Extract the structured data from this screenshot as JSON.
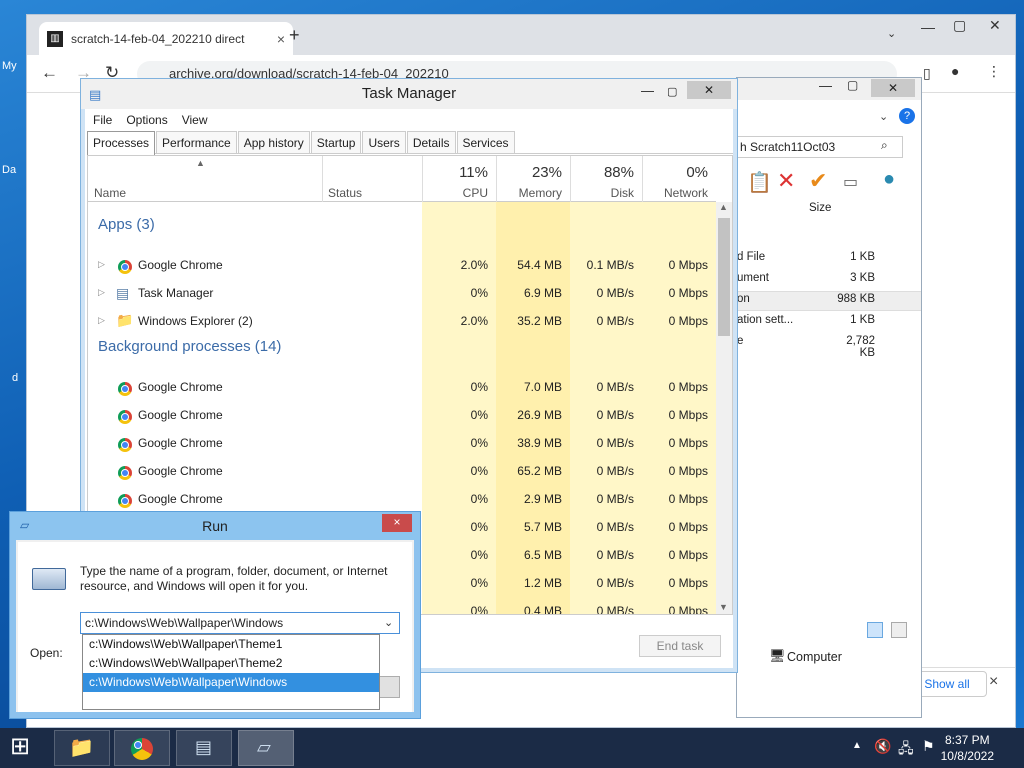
{
  "desktop": {
    "label_my": "My",
    "label_da": "Da",
    "label_d": "d"
  },
  "browser": {
    "tab_title": "scratch-14-feb-04_202210 direct",
    "tab_close": "×",
    "new_tab": "+",
    "url": "archive.org/download/scratch-14-feb-04_202210",
    "show_all": "Show all",
    "close_bar": "×"
  },
  "explorer": {
    "search_text": "h Scratch11Oct03",
    "size_header": "Size",
    "files": [
      {
        "name": "d File",
        "size": "1 KB"
      },
      {
        "name": "ument",
        "size": "3 KB"
      },
      {
        "name": "on",
        "size": "988 KB"
      },
      {
        "name": "ation sett...",
        "size": "1 KB"
      },
      {
        "name": "e",
        "size": "2,782 KB"
      }
    ],
    "status": "Computer"
  },
  "task_manager": {
    "title": "Task Manager",
    "menu": [
      "File",
      "Options",
      "View"
    ],
    "tabs": [
      "Processes",
      "Performance",
      "App history",
      "Startup",
      "Users",
      "Details",
      "Services"
    ],
    "columns": {
      "name": "Name",
      "status": "Status",
      "cpu": "CPU",
      "memory": "Memory",
      "disk": "Disk",
      "network": "Network"
    },
    "totals": {
      "cpu": "11%",
      "memory": "23%",
      "disk": "88%",
      "network": "0%"
    },
    "apps_group": "Apps (3)",
    "apps": [
      {
        "name": "Google Chrome",
        "cpu": "2.0%",
        "mem": "54.4 MB",
        "disk": "0.1 MB/s",
        "net": "0 Mbps"
      },
      {
        "name": "Task Manager",
        "cpu": "0%",
        "mem": "6.9 MB",
        "disk": "0 MB/s",
        "net": "0 Mbps"
      },
      {
        "name": "Windows Explorer (2)",
        "cpu": "2.0%",
        "mem": "35.2 MB",
        "disk": "0 MB/s",
        "net": "0 Mbps"
      }
    ],
    "bg_group": "Background processes (14)",
    "bg": [
      {
        "name": "Google Chrome",
        "cpu": "0%",
        "mem": "7.0 MB",
        "disk": "0 MB/s",
        "net": "0 Mbps"
      },
      {
        "name": "Google Chrome",
        "cpu": "0%",
        "mem": "26.9 MB",
        "disk": "0 MB/s",
        "net": "0 Mbps"
      },
      {
        "name": "Google Chrome",
        "cpu": "0%",
        "mem": "38.9 MB",
        "disk": "0 MB/s",
        "net": "0 Mbps"
      },
      {
        "name": "Google Chrome",
        "cpu": "0%",
        "mem": "65.2 MB",
        "disk": "0 MB/s",
        "net": "0 Mbps"
      },
      {
        "name": "Google Chrome",
        "cpu": "0%",
        "mem": "2.9 MB",
        "disk": "0 MB/s",
        "net": "0 Mbps"
      },
      {
        "name": "",
        "cpu": "0%",
        "mem": "5.7 MB",
        "disk": "0 MB/s",
        "net": "0 Mbps"
      },
      {
        "name": "",
        "cpu": "0%",
        "mem": "6.5 MB",
        "disk": "0 MB/s",
        "net": "0 Mbps"
      },
      {
        "name": "",
        "cpu": "0%",
        "mem": "1.2 MB",
        "disk": "0 MB/s",
        "net": "0 Mbps"
      },
      {
        "name": "",
        "cpu": "0%",
        "mem": "0.4 MB",
        "disk": "0 MB/s",
        "net": "0 Mbps"
      }
    ],
    "end_task": "End task"
  },
  "run": {
    "title": "Run",
    "close": "×",
    "description": "Type the name of a program, folder, document, or Internet resource, and Windows will open it for you.",
    "open_label": "Open:",
    "input_value": "c:\\Windows\\Web\\Wallpaper\\Windows",
    "options": [
      "c:\\Windows\\Web\\Wallpaper\\Theme1",
      "c:\\Windows\\Web\\Wallpaper\\Theme2",
      "c:\\Windows\\Web\\Wallpaper\\Windows"
    ],
    "selected_index": 2
  },
  "taskbar": {
    "time": "8:37 PM",
    "date": "10/8/2022"
  }
}
